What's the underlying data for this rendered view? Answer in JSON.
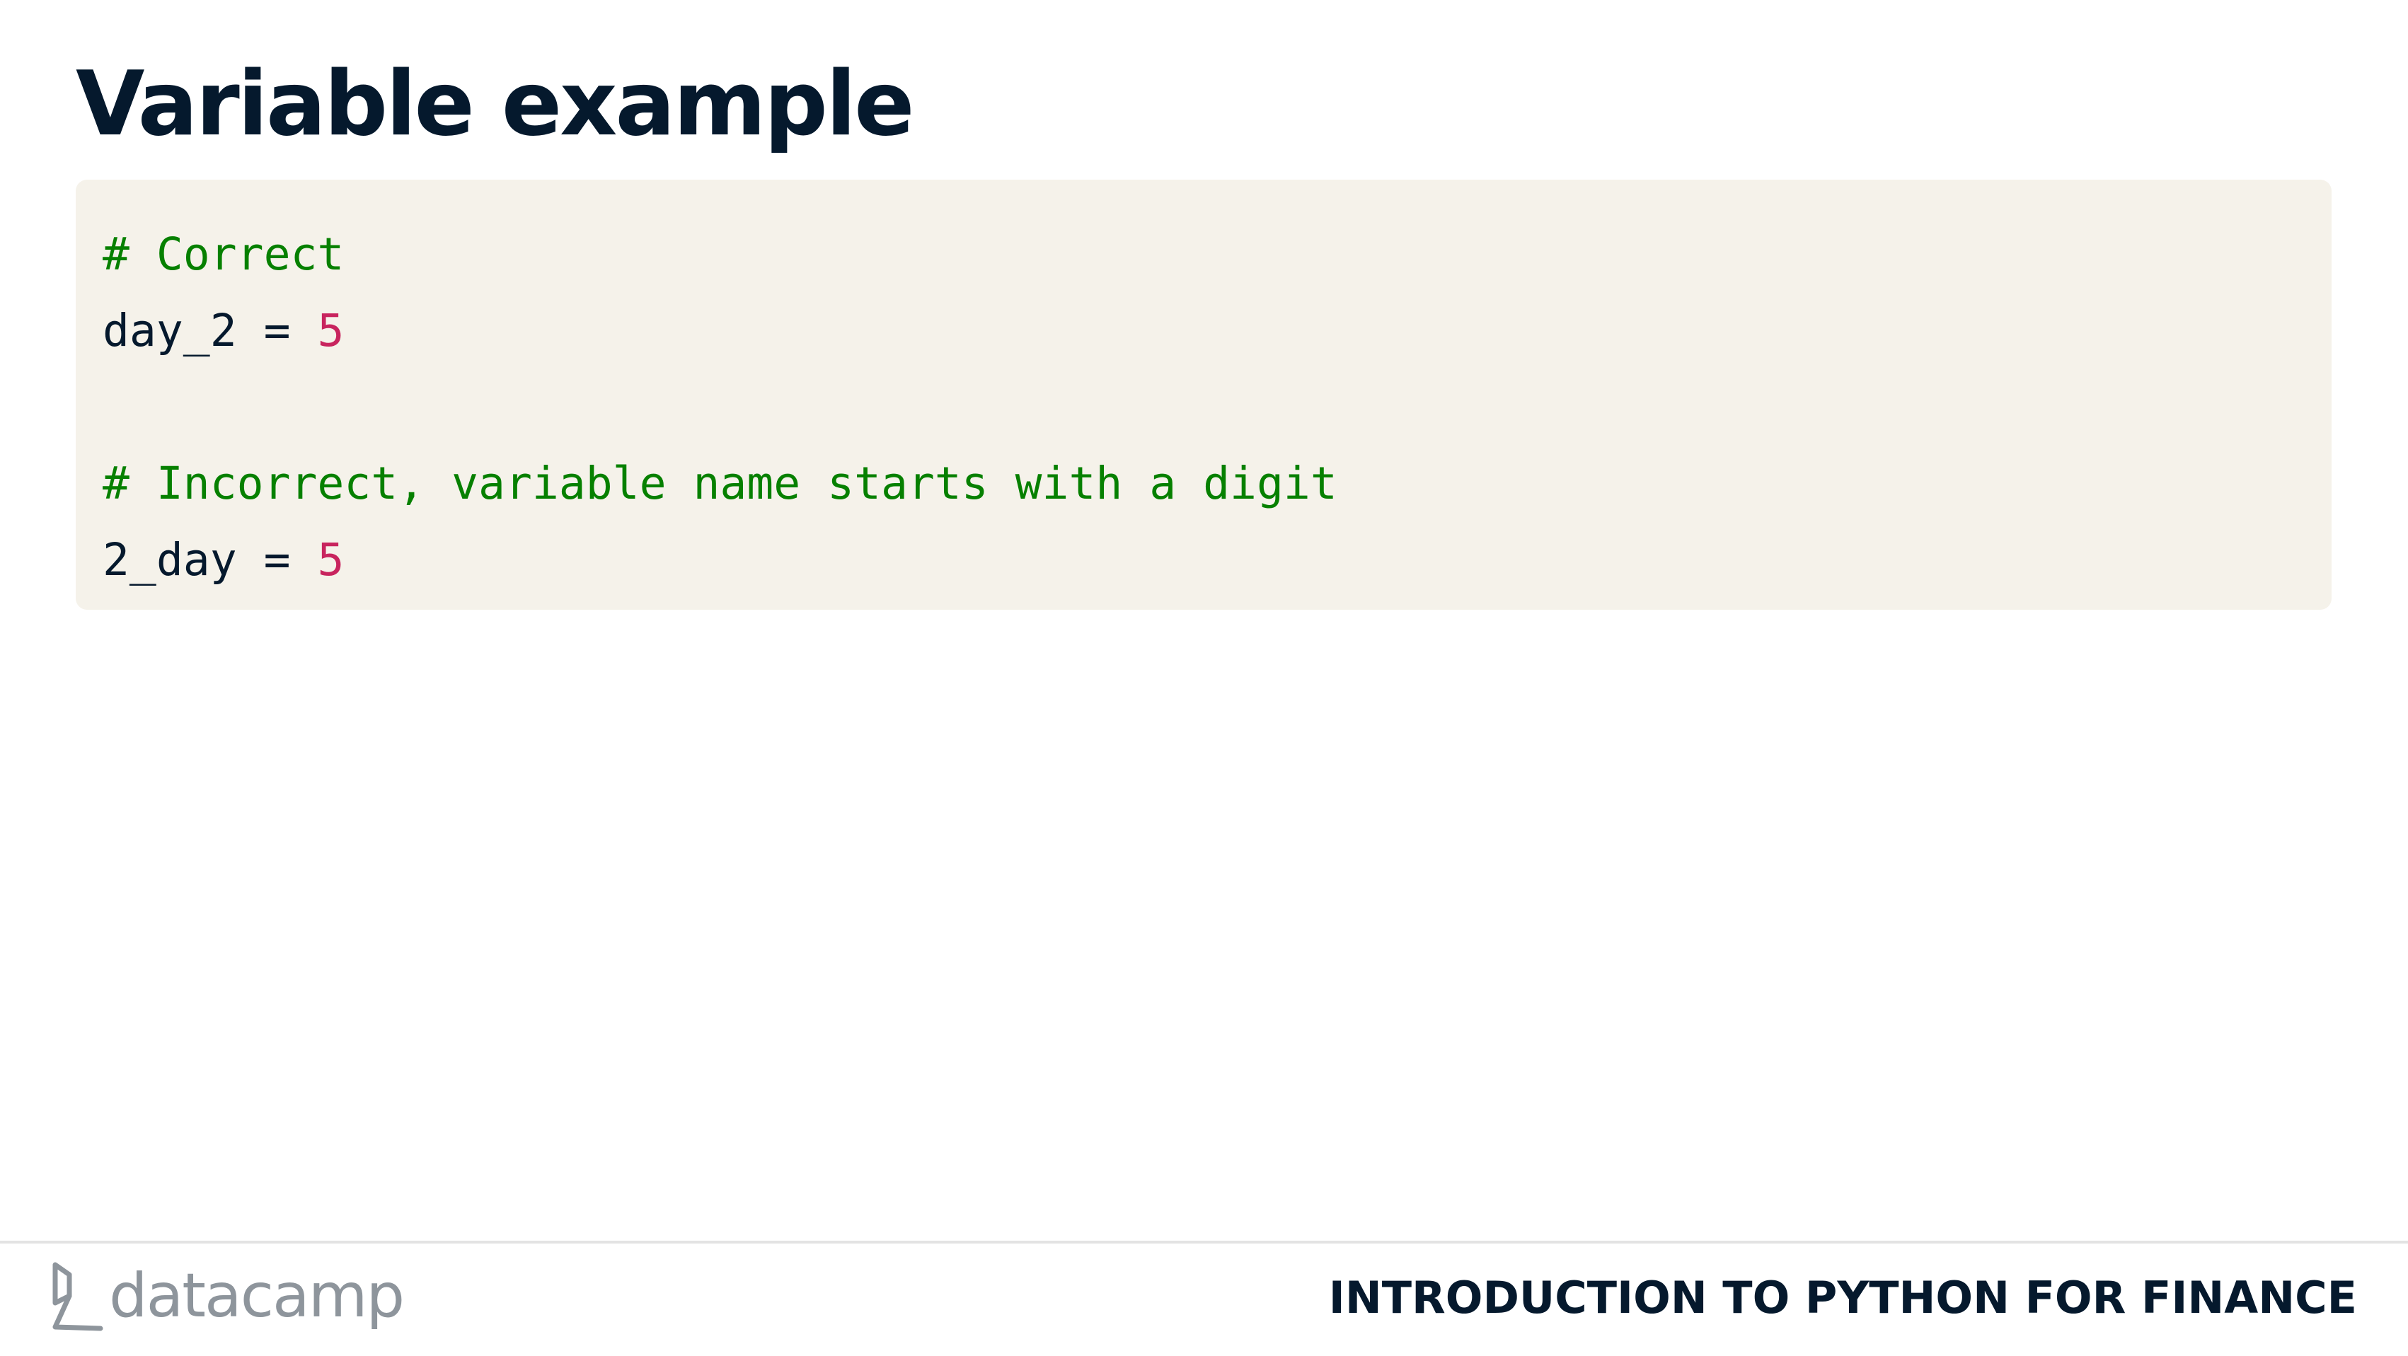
{
  "slide": {
    "title": "Variable example"
  },
  "code": {
    "line1_comment": "# Correct",
    "line2_code": "day_2 = ",
    "line2_number": "5",
    "line3_blank": "",
    "line4_comment": "# Incorrect, variable name starts with a digit",
    "line5_code": "2_day = ",
    "line5_number": "5"
  },
  "footer": {
    "brand": "datacamp",
    "course_title": "INTRODUCTION TO PYTHON FOR FINANCE"
  },
  "colors": {
    "title_text": "#05192d",
    "code_background": "#f5f2ea",
    "comment": "#068000",
    "number": "#c8245e",
    "logo_gray": "#8e959c"
  },
  "icons": {
    "logo": "datacamp-logo-icon"
  }
}
